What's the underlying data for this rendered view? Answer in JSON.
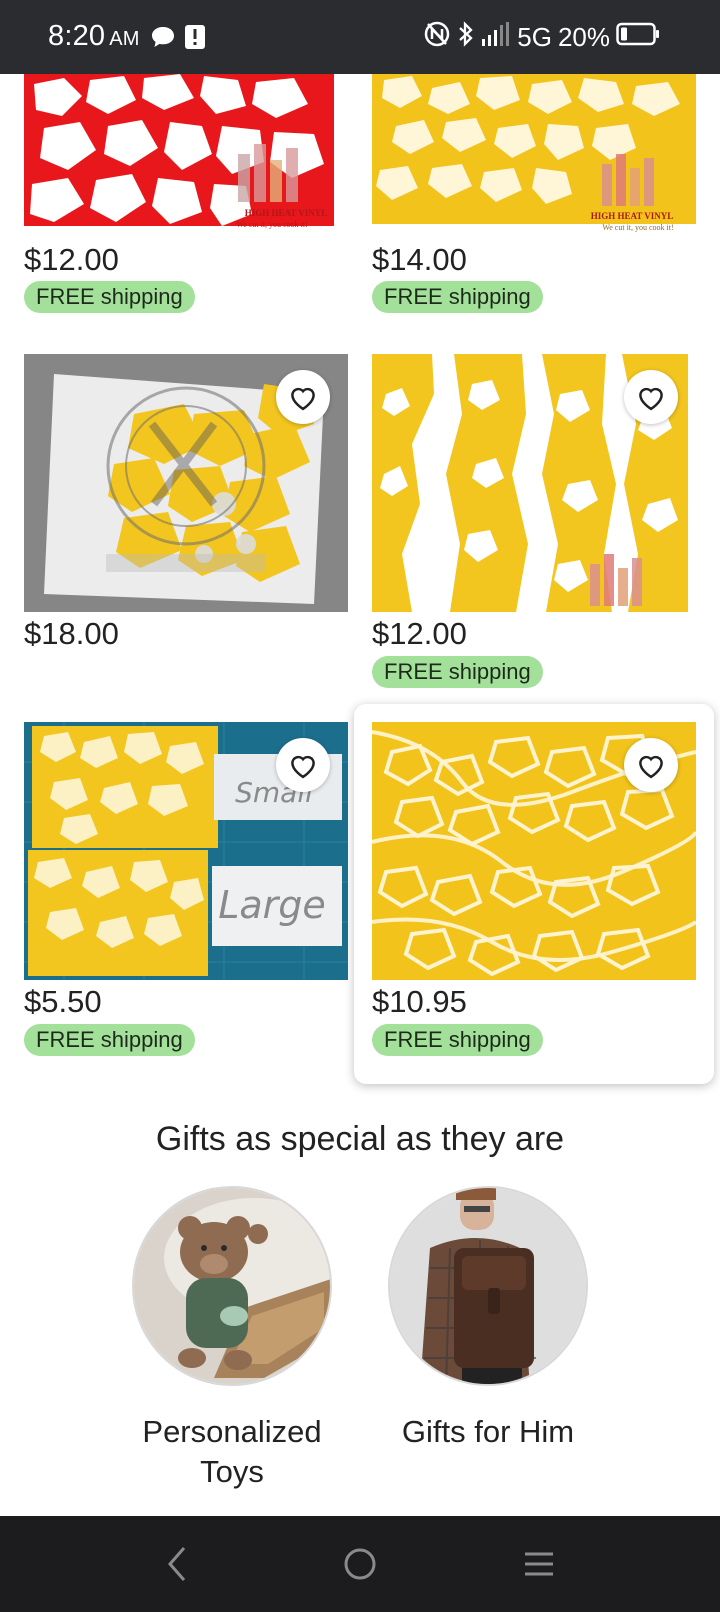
{
  "status_bar": {
    "time": "8:20",
    "ampm": "AM",
    "network": "5G",
    "battery": "20%"
  },
  "listings": [
    {
      "price": "$12.00",
      "shipping": "FREE shipping",
      "watermark": "HIGH HEAT VINYL",
      "tagline": "We cut it, you cook it!"
    },
    {
      "price": "$14.00",
      "shipping": "FREE shipping",
      "watermark": "HIGH HEAT VINYL",
      "tagline": "We cut it, you cook it!"
    },
    {
      "price": "$18.00",
      "shipping": ""
    },
    {
      "price": "$12.00",
      "shipping": "FREE shipping"
    },
    {
      "price": "$5.50",
      "shipping": "FREE shipping",
      "sign_small": "Small",
      "sign_large": "Large"
    },
    {
      "price": "$10.95",
      "shipping": "FREE shipping"
    }
  ],
  "gifts": {
    "title": "Gifts as special as they are",
    "items": [
      {
        "label": "Personalized Toys"
      },
      {
        "label": "Gifts for Him"
      }
    ]
  },
  "colors": {
    "status_bar_bg": "#2b2c30",
    "nav_bar_bg": "#1c1c1f",
    "shipping_badge": "#a3e09a",
    "vinyl_red": "#e8171b",
    "vinyl_yellow": "#f2c31a"
  },
  "icons": {
    "favorite": "heart-outline-icon",
    "back": "chevron-left-icon",
    "home": "circle-home-icon",
    "menu": "hamburger-menu-icon"
  }
}
